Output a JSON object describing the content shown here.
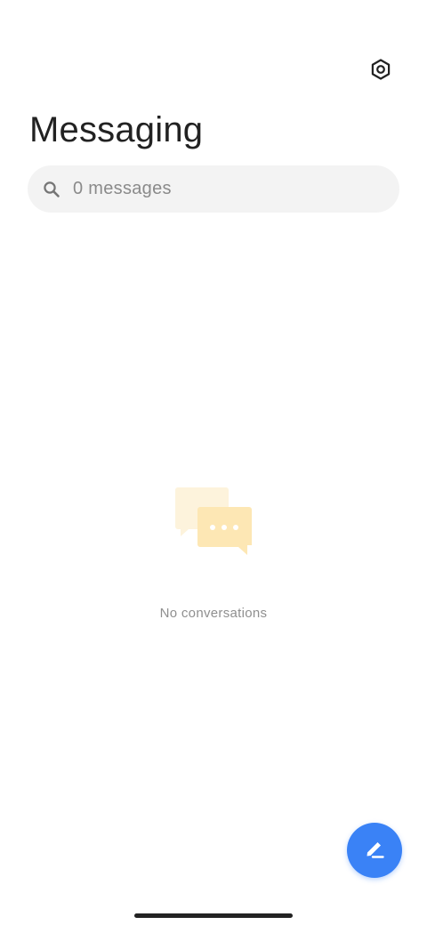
{
  "header": {
    "title": "Messaging",
    "settings_icon": "settings-icon"
  },
  "search": {
    "placeholder": "0 messages",
    "icon": "search-icon"
  },
  "empty_state": {
    "illustration": "chat-bubbles-icon",
    "message": "No conversations"
  },
  "fab": {
    "icon": "compose-pencil-icon",
    "color": "#3a82f6"
  },
  "colors": {
    "accent": "#3a82f6",
    "illustration_back": "#fdf3dc",
    "illustration_front": "#fde7b4"
  }
}
